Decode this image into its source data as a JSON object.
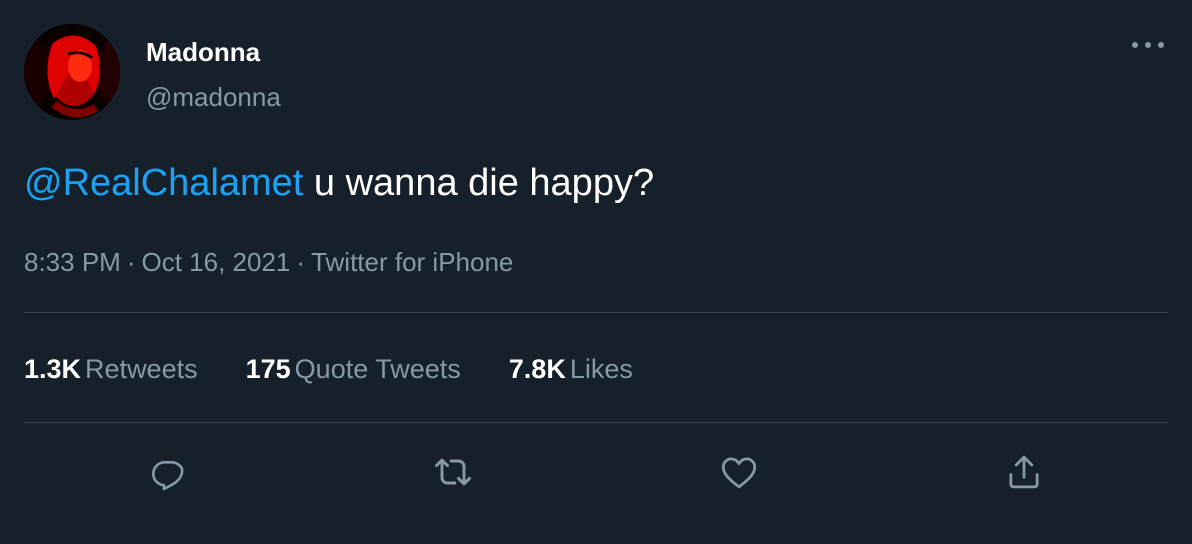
{
  "author": {
    "name": "Madonna",
    "handle": "@madonna"
  },
  "tweet": {
    "mention": "@RealChalamet",
    "text": " u wanna die happy?"
  },
  "meta": {
    "time": "8:33 PM",
    "separator": "·",
    "date": "Oct 16, 2021",
    "source": "Twitter for iPhone"
  },
  "stats": [
    {
      "count": "1.3K",
      "label": "Retweets"
    },
    {
      "count": "175",
      "label": "Quote Tweets"
    },
    {
      "count": "7.8K",
      "label": "Likes"
    }
  ],
  "icons": {
    "more": "more-horizontal-icon",
    "reply": "reply-icon",
    "retweet": "retweet-icon",
    "like": "heart-icon",
    "share": "share-icon"
  },
  "colors": {
    "background": "#15202b",
    "text_primary": "#ffffff",
    "text_secondary": "#8899a6",
    "link": "#1da1f2",
    "divider": "#38444d",
    "avatar_accent": "#e00000"
  }
}
